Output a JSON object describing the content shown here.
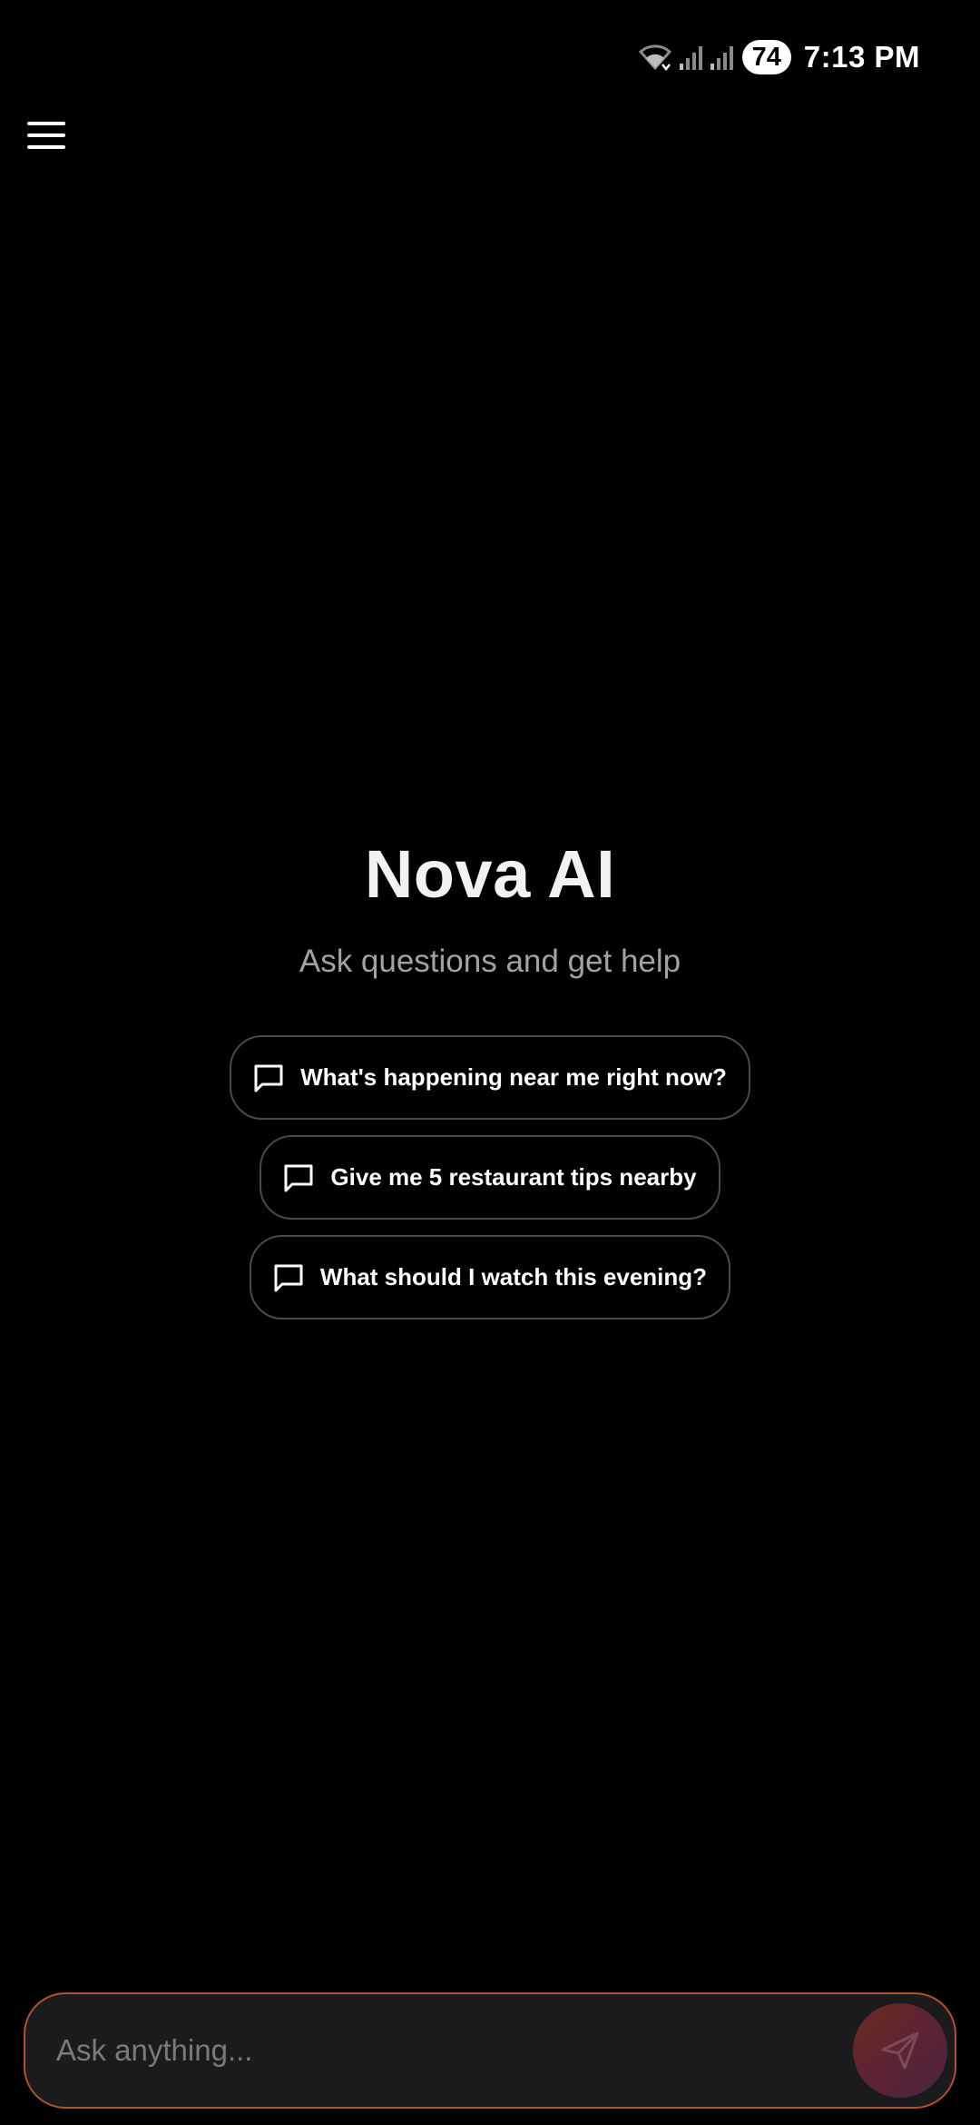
{
  "status_bar": {
    "battery": "74",
    "time": "7:13 PM",
    "icons": [
      "wifi-icon",
      "signal-icon",
      "signal-icon"
    ]
  },
  "header": {
    "menu_icon": "hamburger-menu-icon"
  },
  "hero": {
    "title": "Nova AI",
    "subtitle": "Ask questions and get help"
  },
  "suggestions": [
    {
      "label": "What's happening near me right now?",
      "icon": "chat-bubble-icon"
    },
    {
      "label": "Give me 5 restaurant tips nearby",
      "icon": "chat-bubble-icon"
    },
    {
      "label": "What should I watch this evening?",
      "icon": "chat-bubble-icon"
    }
  ],
  "composer": {
    "placeholder": "Ask anything...",
    "value": "",
    "send_icon": "send-icon"
  },
  "colors": {
    "background": "#000000",
    "accent_border": "#b0522f",
    "chip_border": "#4a4a4a",
    "subtitle": "#a2a2a2"
  }
}
